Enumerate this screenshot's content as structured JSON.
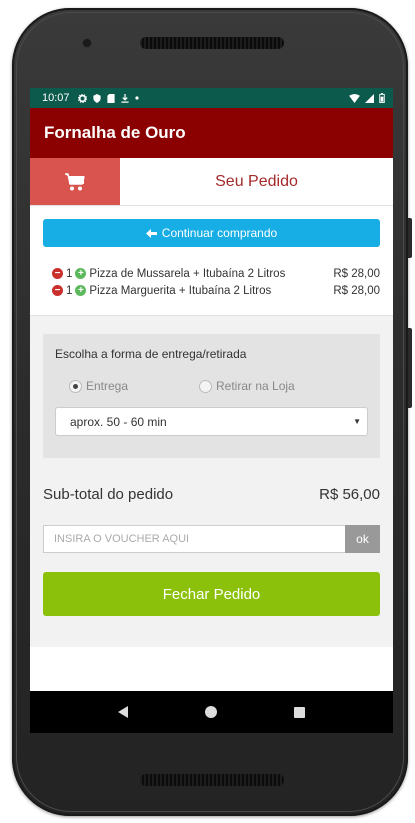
{
  "status_bar": {
    "time": "10:07",
    "icons": [
      "settings-icon",
      "shield-icon",
      "sd-card-icon",
      "download-icon",
      "dot-icon"
    ],
    "right_icons": [
      "wifi-icon",
      "signal-icon",
      "battery-icon"
    ]
  },
  "app": {
    "title": "Fornalha de Ouro",
    "brand_color": "#8b0000"
  },
  "header": {
    "cart_icon": "cart-icon",
    "title": "Seu Pedido"
  },
  "continue_button": {
    "icon": "arrow-left-icon",
    "label": "Continuar comprando"
  },
  "order_items": [
    {
      "qty": "1",
      "name": "Pizza de Mussarela + Itubaína 2 Litros",
      "price": "R$ 28,00"
    },
    {
      "qty": "1",
      "name": "Pizza Marguerita + Itubaína 2 Litros",
      "price": "R$ 28,00"
    }
  ],
  "delivery": {
    "title": "Escolha a forma de entrega/retirada",
    "options": [
      {
        "label": "Entrega",
        "checked": true
      },
      {
        "label": "Retirar na Loja",
        "checked": false
      }
    ],
    "time_select": "aprox. 50 - 60 min"
  },
  "subtotal": {
    "label": "Sub-total do pedido",
    "value": "R$ 56,00"
  },
  "voucher": {
    "placeholder": "INSIRA O VOUCHER AQUI",
    "button": "ok"
  },
  "close_order": {
    "label": "Fechar Pedido",
    "color": "#8bc10a"
  },
  "nav_bar": {
    "icons": [
      "back-icon",
      "home-icon",
      "recents-icon"
    ]
  }
}
